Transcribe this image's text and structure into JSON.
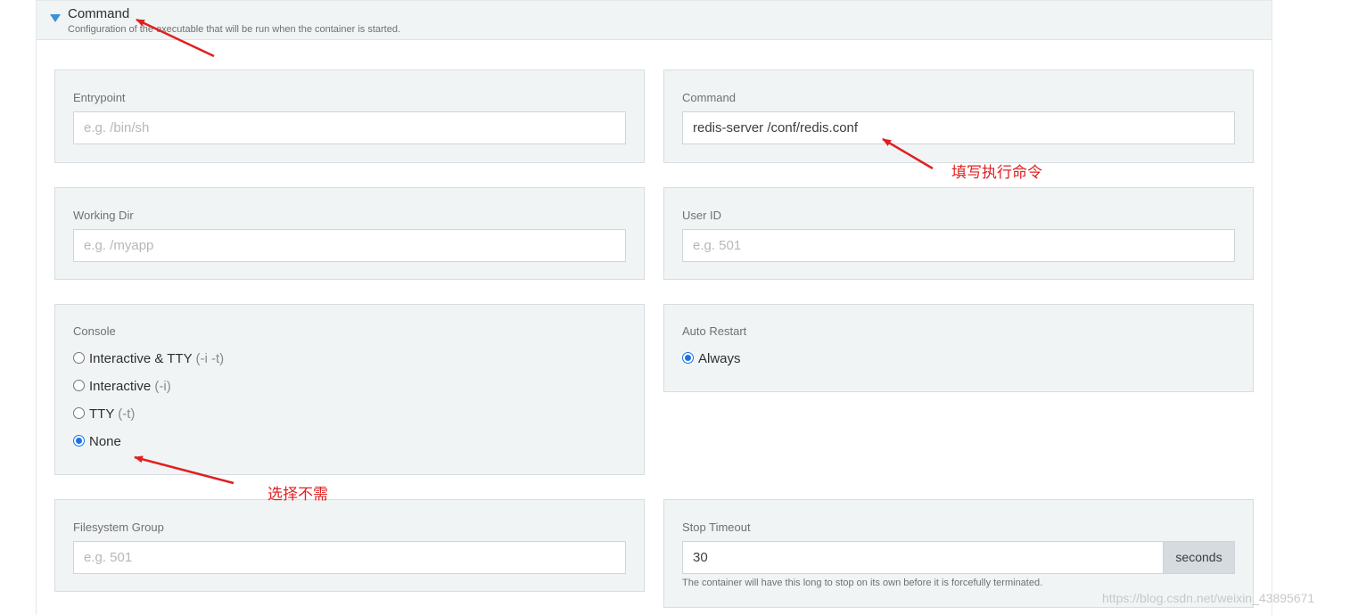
{
  "section": {
    "title": "Command",
    "subtitle": "Configuration of the executable that will be run when the container is started."
  },
  "entrypoint": {
    "label": "Entrypoint",
    "placeholder": "e.g. /bin/sh",
    "value": ""
  },
  "command": {
    "label": "Command",
    "placeholder": "",
    "value": "redis-server /conf/redis.conf"
  },
  "working_dir": {
    "label": "Working Dir",
    "placeholder": "e.g. /myapp",
    "value": ""
  },
  "user_id": {
    "label": "User ID",
    "placeholder": "e.g. 501",
    "value": ""
  },
  "console": {
    "label": "Console",
    "options": [
      {
        "label": "Interactive & TTY",
        "hint": "(-i -t)",
        "checked": false
      },
      {
        "label": "Interactive",
        "hint": "(-i)",
        "checked": false
      },
      {
        "label": "TTY",
        "hint": "(-t)",
        "checked": false
      },
      {
        "label": "None",
        "hint": "",
        "checked": true
      }
    ]
  },
  "auto_restart": {
    "label": "Auto Restart",
    "options": [
      {
        "label": "Always",
        "checked": true
      }
    ]
  },
  "filesystem_group": {
    "label": "Filesystem Group",
    "placeholder": "e.g. 501",
    "value": ""
  },
  "stop_timeout": {
    "label": "Stop Timeout",
    "value": "30",
    "unit": "seconds",
    "help": "The container will have this long to stop on its own before it is forcefully terminated."
  },
  "annotations": {
    "command_note": "填写执行命令",
    "console_note": "选择不需"
  },
  "watermark": "https://blog.csdn.net/weixin_43895671",
  "colors": {
    "accent": "#1a73e8",
    "annotation": "#e02020",
    "panel_bg": "#f1f4f5"
  }
}
